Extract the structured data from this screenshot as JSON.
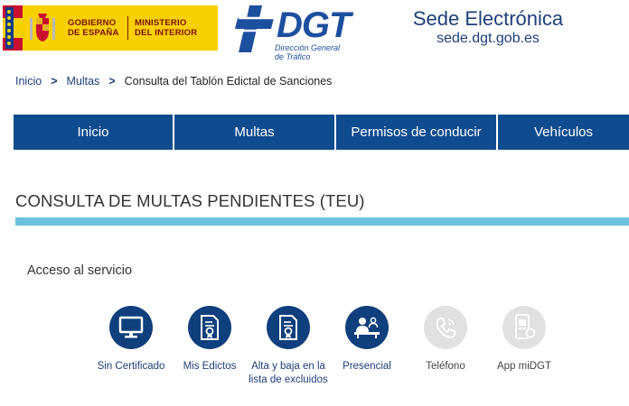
{
  "header": {
    "gov_line1_a": "GOBIERNO",
    "gov_line1_b": "DE ESPAÑA",
    "gov_line2_a": "MINISTERIO",
    "gov_line2_b": "DEL INTERIOR",
    "dgt_word": "DGT",
    "dgt_sub_a": "Dirección General",
    "dgt_sub_b": "de Tráfico",
    "sede_title": "Sede Electrónica",
    "sede_url": "sede.dgt.gob.es"
  },
  "breadcrumb": {
    "items": [
      "Inicio",
      "Multas",
      "Consulta del Tablón Edictal de Sanciones"
    ],
    "separator": ">"
  },
  "nav": {
    "items": [
      "Inicio",
      "Multas",
      "Permisos de conducir",
      "Vehículos"
    ]
  },
  "main": {
    "title": "CONSULTA DE MULTAS PENDIENTES (TEU)",
    "section_label": "Acceso al servicio",
    "services": [
      {
        "label": "Sin Certificado",
        "icon": "monitor-icon",
        "enabled": true
      },
      {
        "label": "Mis Edictos",
        "icon": "document-seal-icon",
        "enabled": true
      },
      {
        "label": "Alta y baja en la lista de excluidos",
        "icon": "document-seal-icon",
        "enabled": true
      },
      {
        "label": "Presencial",
        "icon": "person-desk-icon",
        "enabled": true
      },
      {
        "label": "Teléfono",
        "icon": "phone-icon",
        "enabled": false
      },
      {
        "label": "App miDGT",
        "icon": "mobile-app-icon",
        "enabled": false
      }
    ]
  },
  "colors": {
    "nav_bg": "#0f4c8f",
    "accent_bar": "#6bc2de",
    "icon_active": "#0f3f7c",
    "icon_disabled": "#e1e1e1",
    "gov_yellow": "#f8d000"
  }
}
